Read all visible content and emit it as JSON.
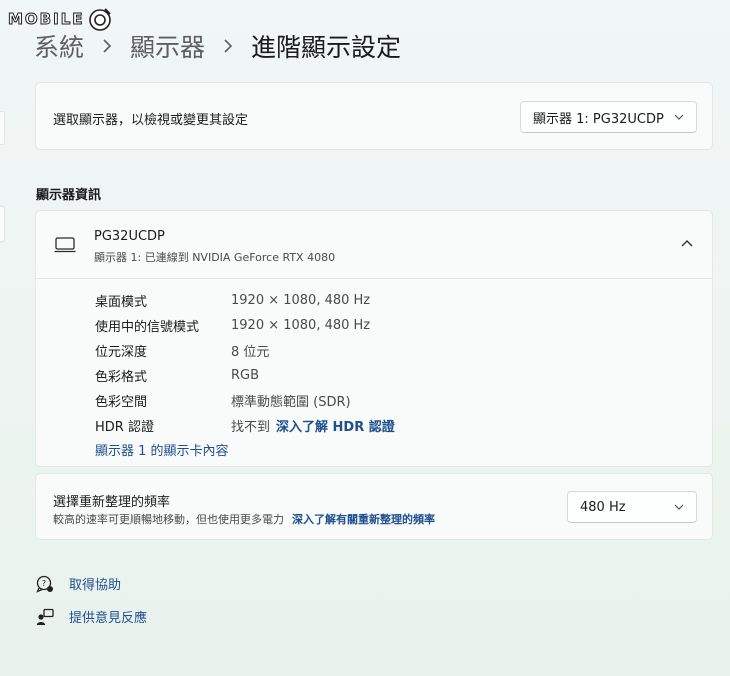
{
  "watermark": {
    "text": "MOBILE"
  },
  "breadcrumb": {
    "items": [
      "系統",
      "顯示器",
      "進階顯示設定"
    ]
  },
  "select_display": {
    "label": "選取顯示器，以檢視或變更其設定",
    "value": "顯示器 1: PG32UCDP"
  },
  "display_info": {
    "section_title": "顯示器資訊",
    "monitor_name": "PG32UCDP",
    "monitor_sub": "顯示器 1: 已連線到 NVIDIA GeForce RTX 4080",
    "rows": [
      {
        "key": "桌面模式",
        "value": "1920 × 1080, 480 Hz"
      },
      {
        "key": "使用中的信號模式",
        "value": "1920 × 1080, 480 Hz"
      },
      {
        "key": "位元深度",
        "value": "8 位元"
      },
      {
        "key": "色彩格式",
        "value": "RGB"
      },
      {
        "key": "色彩空間",
        "value": "標準動態範圍 (SDR)"
      }
    ],
    "hdr": {
      "key": "HDR 認證",
      "value": "找不到",
      "link": "深入了解 HDR 認證"
    },
    "adapter_link": "顯示器 1 的顯示卡內容"
  },
  "refresh_rate": {
    "label": "選擇重新整理的頻率",
    "sub": "較高的速率可更順暢地移動，但也使用更多電力",
    "link": "深入了解有關重新整理的頻率",
    "value": "480 Hz"
  },
  "footer": {
    "help": "取得協助",
    "feedback": "提供意見反應"
  },
  "colors": {
    "accent_link": "#1f4f8f",
    "card_bg": "#f8fbfa"
  },
  "icons": [
    "monitor-icon",
    "chevron-down-icon",
    "chevron-up-icon",
    "chevron-right-icon",
    "help-icon",
    "feedback-icon"
  ]
}
